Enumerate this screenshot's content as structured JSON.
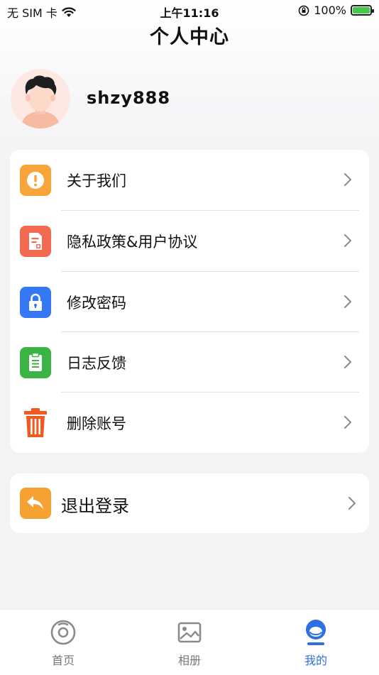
{
  "status_bar": {
    "carrier": "无 SIM 卡",
    "time": "上午11:16",
    "battery": "100%"
  },
  "header": {
    "title": "个人中心"
  },
  "profile": {
    "username": "shzy888"
  },
  "menu": {
    "items": [
      {
        "label": "关于我们",
        "icon": "info-icon",
        "color": "#f7a53a"
      },
      {
        "label": "隐私政策&用户协议",
        "icon": "document-icon",
        "color": "#f26a4f"
      },
      {
        "label": "修改密码",
        "icon": "lock-icon",
        "color": "#3478f6"
      },
      {
        "label": "日志反馈",
        "icon": "clipboard-icon",
        "color": "#3cb347"
      },
      {
        "label": "删除账号",
        "icon": "trash-icon",
        "color": "#f05a1e"
      }
    ]
  },
  "logout": {
    "label": "退出登录",
    "icon": "back-arrow-icon",
    "color": "#f6a233"
  },
  "tab_bar": {
    "tabs": [
      {
        "label": "首页",
        "icon": "home-icon"
      },
      {
        "label": "相册",
        "icon": "photo-album-icon"
      },
      {
        "label": "我的",
        "icon": "user-icon"
      }
    ],
    "active": "我的",
    "active_color": "#2f6fe4"
  }
}
